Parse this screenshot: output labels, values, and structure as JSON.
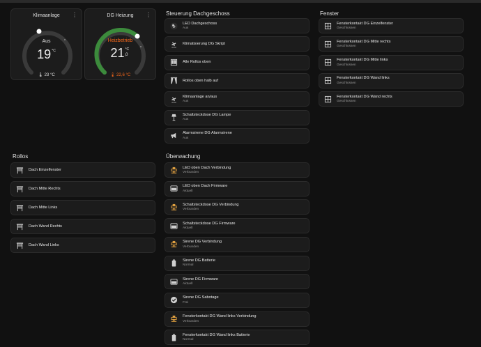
{
  "thermostats": [
    {
      "title": "Klimaanlage",
      "mode": "Aus",
      "setpoint": "19",
      "setpoint_sup": "°C",
      "current": "🌡 23 °C"
    },
    {
      "title": "DG Heizung",
      "mode": "Heizbetrieb",
      "setpoint": "21",
      "setpoint_sup": "°C",
      "setpoint_decimal": ",0",
      "current": "🌡 22,6 °C"
    }
  ],
  "colors": {
    "accent_green": "#3c8b3c",
    "heat_orange": "#ff6a1a",
    "background": "#111111",
    "card": "#1c1c1c"
  },
  "rollos": {
    "title": "Rollos",
    "items": [
      {
        "name": "Dach Einzelfenster",
        "icon": "shutter-icon"
      },
      {
        "name": "Dach Mitte Rechts",
        "icon": "shutter-icon"
      },
      {
        "name": "Dach Mitte Links",
        "icon": "shutter-icon"
      },
      {
        "name": "Dach Wand Rechts",
        "icon": "shutter-icon"
      },
      {
        "name": "Dach Wand Links",
        "icon": "shutter-icon"
      }
    ]
  },
  "steuerung": {
    "title": "Steuerung Dachgeschoss",
    "items": [
      {
        "name": "LED Dachgeschoss",
        "state": "Aus",
        "icon": "lightbulb-icon"
      },
      {
        "name": "Klimatisierung DG Skript",
        "state": "",
        "icon": "fan-auto-icon"
      },
      {
        "name": "Alle Rollos oben",
        "state": "",
        "icon": "window-shutter-icon"
      },
      {
        "name": "Rollos oben halb auf",
        "state": "",
        "icon": "curtains-icon"
      },
      {
        "name": "Klimaanlage an/aus",
        "state": "Aus",
        "icon": "fan-auto-icon"
      },
      {
        "name": "Schaltsteckdose DG Lampe",
        "state": "Aus",
        "icon": "floor-lamp-icon"
      },
      {
        "name": "Alarmsirene DG Alarmsirene",
        "state": "Aus",
        "icon": "bullhorn-icon"
      }
    ]
  },
  "ueberwachung": {
    "title": "Überwachung",
    "items": [
      {
        "name": "LED oben Dach Verbindung",
        "state": "Verbunden",
        "icon": "connection-icon"
      },
      {
        "name": "LED oben Dach Firmware",
        "state": "Aktuell",
        "icon": "firmware-icon"
      },
      {
        "name": "Schaltsteckdose DG Verbindung",
        "state": "Verbunden",
        "icon": "connection-icon"
      },
      {
        "name": "Schaltsteckdose DG Firmware",
        "state": "Aktuell",
        "icon": "firmware-icon"
      },
      {
        "name": "Sirene DG Verbindung",
        "state": "Verbunden",
        "icon": "connection-icon"
      },
      {
        "name": "Sirene DG Batterie",
        "state": "Normal",
        "icon": "battery-icon"
      },
      {
        "name": "Sirene DG Firmware",
        "state": "Aktuell",
        "icon": "firmware-icon"
      },
      {
        "name": "Sirene DG Sabotage",
        "state": "Frei",
        "icon": "check-circle-icon"
      },
      {
        "name": "Fensterkontakt DG Wand links Verbindung",
        "state": "Verbunden",
        "icon": "connection-icon"
      },
      {
        "name": "Fensterkontakt DG Wand links Batterie",
        "state": "Normal",
        "icon": "battery-icon"
      }
    ]
  },
  "fenster": {
    "title": "Fenster",
    "items": [
      {
        "name": "Fensterkontakt DG Einzelfenster",
        "state": "Geschlossen",
        "icon": "window-closed-icon"
      },
      {
        "name": "Fensterkontakt DG Mitte rechts",
        "state": "Geschlossen",
        "icon": "window-closed-icon"
      },
      {
        "name": "Fensterkontakt DG Mitte links",
        "state": "Geschlossen",
        "icon": "window-closed-icon"
      },
      {
        "name": "Fensterkontakt DG Wand links",
        "state": "Geschlossen",
        "icon": "window-closed-icon"
      },
      {
        "name": "Fensterkontakt DG Wand rechts",
        "state": "Geschlossen",
        "icon": "window-closed-icon"
      }
    ]
  },
  "menu_glyph": "⋮"
}
